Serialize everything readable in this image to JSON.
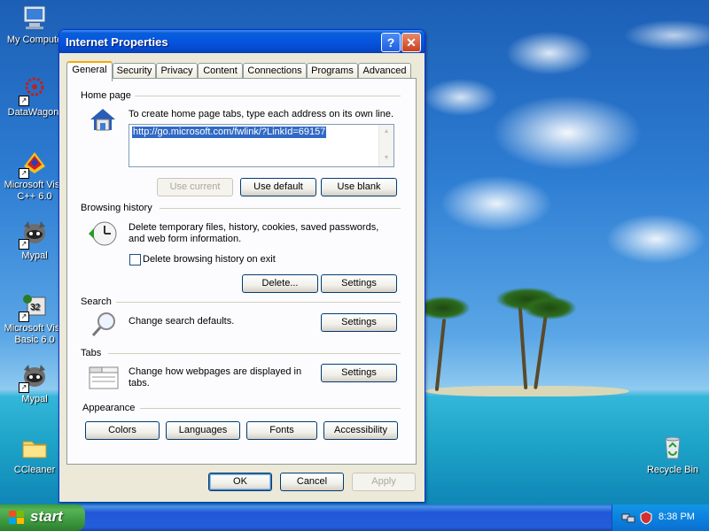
{
  "desktop": {
    "icons": [
      {
        "label": "My Compute",
        "icon": "computer-icon"
      },
      {
        "label": "DataWagon.",
        "icon": "datawagon-icon"
      },
      {
        "label": "Microsoft Visu C++ 6.0",
        "icon": "visual-cpp-icon"
      },
      {
        "label": "Mypal",
        "icon": "mypal-icon"
      },
      {
        "label": "Microsoft Visu Basic 6.0",
        "icon": "visual-basic-icon"
      },
      {
        "label": "Mypal",
        "icon": "mypal-icon"
      },
      {
        "label": "CCleaner",
        "icon": "folder-icon"
      },
      {
        "label": "Recycle Bin",
        "icon": "recycle-bin-icon"
      }
    ]
  },
  "dialog": {
    "title": "Internet Properties",
    "help_glyph": "?",
    "close_glyph": "✕",
    "tabs": [
      "General",
      "Security",
      "Privacy",
      "Content",
      "Connections",
      "Programs",
      "Advanced"
    ],
    "active_tab": "General",
    "home_page": {
      "title": "Home page",
      "description": "To create home page tabs, type each address on its own line.",
      "url_value": "http://go.microsoft.com/fwlink/?LinkId=69157",
      "buttons": {
        "use_current": "Use current",
        "use_default": "Use default",
        "use_blank": "Use blank"
      }
    },
    "browsing_history": {
      "title": "Browsing history",
      "description": "Delete temporary files, history, cookies, saved passwords, and web form information.",
      "checkbox_label": "Delete browsing history on exit",
      "checkbox_checked": false,
      "buttons": {
        "delete": "Delete...",
        "settings": "Settings"
      }
    },
    "search": {
      "title": "Search",
      "description": "Change search defaults.",
      "settings": "Settings"
    },
    "tabs_section": {
      "title": "Tabs",
      "description": "Change how webpages are displayed in tabs.",
      "settings": "Settings"
    },
    "appearance": {
      "title": "Appearance",
      "buttons": {
        "colors": "Colors",
        "languages": "Languages",
        "fonts": "Fonts",
        "accessibility": "Accessibility"
      }
    },
    "footer": {
      "ok": "OK",
      "cancel": "Cancel",
      "apply": "Apply"
    }
  },
  "taskbar": {
    "start_label": "start",
    "clock": "8:38 PM"
  },
  "colors": {
    "title_bar": "#0555e0",
    "dialog_face": "#ece9d8",
    "selection": "#316ac5",
    "start_green": "#3a943a",
    "active_tab_accent": "#f4a90c"
  }
}
